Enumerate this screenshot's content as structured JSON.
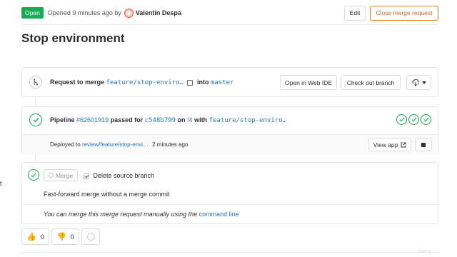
{
  "header": {
    "status_badge": "Open",
    "opened_text": "Opened 9 minutes ago by",
    "author": "Valentin Despa",
    "edit_label": "Edit",
    "close_label": "Close merge request"
  },
  "title": "Stop environment",
  "request": {
    "prefix": "Request to merge",
    "source_branch": "feature/stop-enviro…",
    "into": "into",
    "target_branch": "master",
    "open_ide_label": "Open in Web IDE",
    "checkout_label": "Check out branch"
  },
  "pipeline": {
    "label": "Pipeline",
    "id": "#62601919",
    "passed_for": "passed for",
    "commit": "c548b799",
    "on": "on",
    "mr_ref": "!4",
    "with": "with",
    "branch": "feature/stop-enviro…",
    "stages": [
      "passed",
      "passed",
      "passed"
    ]
  },
  "deployment": {
    "prefix": "Deployed to",
    "env": "review/feature/stop-envi…",
    "time": "2 minutes ago",
    "view_app_label": "View app"
  },
  "merge": {
    "button_label": "Merge",
    "delete_source_label": "Delete source branch",
    "ff_text": "Fast-forward merge without a merge commit",
    "manual_text": "You can merge this merge request manually using the",
    "manual_link": "command line"
  },
  "awards": {
    "thumbs_up_count": "0",
    "thumbs_down_count": "0"
  },
  "side_fragment": "t",
  "watermark": "Udemy",
  "colors": {
    "success": "#1aaa55",
    "link": "#1f78d1",
    "warning": "#e67e22"
  }
}
